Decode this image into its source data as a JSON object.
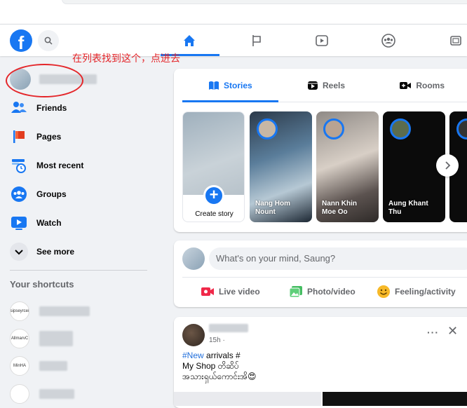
{
  "nav": {
    "logo": "f",
    "icons": [
      "home-icon",
      "flag-icon",
      "video-icon",
      "groups-icon",
      "gaming-icon"
    ]
  },
  "sidebar": {
    "items": [
      {
        "label": "Friends",
        "icon": "friends-icon"
      },
      {
        "label": "Pages",
        "icon": "pages-flag-icon"
      },
      {
        "label": "Most recent",
        "icon": "clock-icon"
      },
      {
        "label": "Groups",
        "icon": "groups-icon"
      },
      {
        "label": "Watch",
        "icon": "watch-icon"
      },
      {
        "label": "See more",
        "icon": "chevron-down-icon"
      }
    ],
    "shortcuts_title": "Your shortcuts",
    "shortcuts": [
      {
        "avatar_text": "sipseyrcel"
      },
      {
        "avatar_text": "AllmarvC"
      },
      {
        "avatar_text": "MinHA"
      },
      {
        "avatar_text": ""
      }
    ]
  },
  "annotation": {
    "text": "在列表找到这个，点进去",
    "color": "#e4262a"
  },
  "stories": {
    "tabs": [
      {
        "label": "Stories",
        "icon": "book-icon",
        "active": true
      },
      {
        "label": "Reels",
        "icon": "reels-icon",
        "active": false
      },
      {
        "label": "Rooms",
        "icon": "video-camera-plus-icon",
        "active": false
      }
    ],
    "create_label": "Create story",
    "items": [
      {
        "name": "Nang Hom\nNount"
      },
      {
        "name": "Nann Khin\nMoe Oo"
      },
      {
        "name": "Aung Khant\nThu"
      }
    ]
  },
  "composer": {
    "placeholder": "What's on your mind, Saung?",
    "actions": [
      {
        "label": "Live video",
        "icon": "live-video-icon",
        "color": "#f02849"
      },
      {
        "label": "Photo/video",
        "icon": "photo-icon",
        "color": "#45bd62"
      },
      {
        "label": "Feeling/activity",
        "icon": "smiley-icon",
        "color": "#f7b928"
      }
    ]
  },
  "post": {
    "time": "15h · ",
    "hashtag": "#New",
    "line1_rest": " arrivals #",
    "line2": "My Shop တိဆိပ်",
    "line3": "အသားရှယ်ကောင်းအိ😍",
    "more": "···",
    "close": "✕"
  },
  "colors": {
    "brand": "#1877f2",
    "background": "#f0f2f5"
  }
}
